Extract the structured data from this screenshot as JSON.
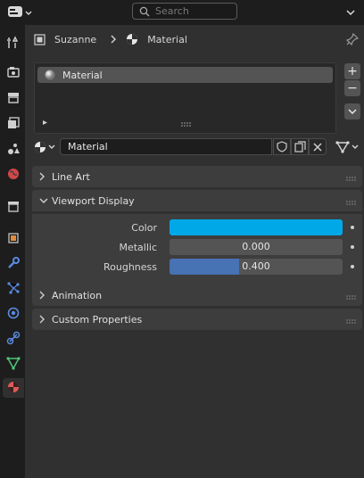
{
  "header": {
    "search_placeholder": "Search"
  },
  "breadcrumb": {
    "object": "Suzanne",
    "material": "Material"
  },
  "material_slots": {
    "items": [
      {
        "label": "Material"
      }
    ],
    "add_label": "+",
    "remove_label": "−",
    "specials_label": "⌄"
  },
  "material_datablock": {
    "name": "Material"
  },
  "panels": {
    "line_art": "Line Art",
    "viewport_display": "Viewport Display",
    "animation": "Animation",
    "custom_properties": "Custom Properties"
  },
  "viewport_display": {
    "color_label": "Color",
    "color_value": "#00a8e8",
    "metallic_label": "Metallic",
    "metallic_value": "0.000",
    "metallic_fraction": 0.0,
    "roughness_label": "Roughness",
    "roughness_value": "0.400",
    "roughness_fraction": 0.4
  },
  "colors": {
    "accent_blue": "#4772b3",
    "active_tab_material": "#e05a5a"
  },
  "tabs": [
    {
      "icon": "tool-icon"
    },
    {
      "icon": "render-icon"
    },
    {
      "icon": "output-icon"
    },
    {
      "icon": "view-layer-icon"
    },
    {
      "icon": "scene-icon"
    },
    {
      "icon": "world-icon"
    },
    {
      "icon": "collection-icon"
    },
    {
      "icon": "object-icon"
    },
    {
      "icon": "modifier-icon"
    },
    {
      "icon": "particles-icon"
    },
    {
      "icon": "physics-icon"
    },
    {
      "icon": "constraints-icon"
    },
    {
      "icon": "data-icon"
    },
    {
      "icon": "material-icon"
    }
  ]
}
